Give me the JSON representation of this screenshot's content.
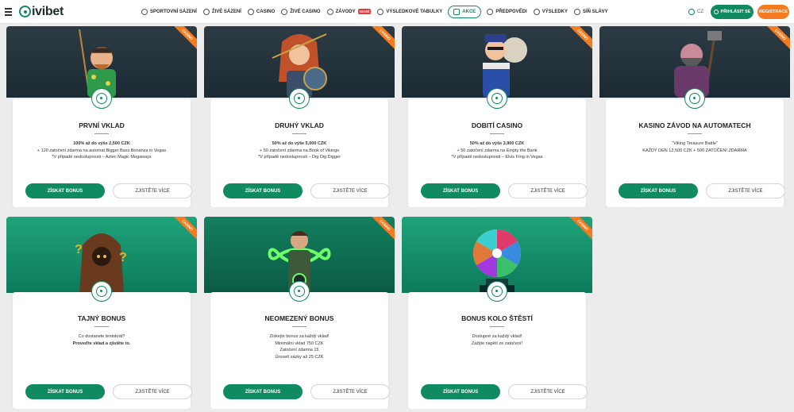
{
  "header": {
    "logo_text": "ivibet",
    "nav": [
      {
        "label": "SPORTOVNÍ SÁZENÍ",
        "icon": "soccer-ball-icon"
      },
      {
        "label": "ŽIVÉ SÁZENÍ",
        "icon": "live-icon"
      },
      {
        "label": "CASINO",
        "icon": "casino-chip-icon"
      },
      {
        "label": "ŽIVÉ CASINO",
        "icon": "live-casino-icon"
      },
      {
        "label": "ZÁVODY",
        "icon": "trophy-icon",
        "badge": "NOVÉ"
      },
      {
        "label": "VÝSLEDKOVÉ TABULKY",
        "icon": "leaderboard-icon"
      },
      {
        "label": "AKCE",
        "icon": "gift-icon",
        "active": true
      },
      {
        "label": "PŘEDPOVĚDI",
        "icon": "prediction-icon"
      },
      {
        "label": "VÝSLEDKY",
        "icon": "results-icon"
      },
      {
        "label": "SÍŇ SLÁVY",
        "icon": "hall-of-fame-icon"
      }
    ],
    "language": "CZ",
    "login_label": "PŘIHLÁSIT SE",
    "register_label": "REGISTRACE"
  },
  "colors": {
    "accent": "#0f8a61",
    "orange": "#f47b20",
    "badge_red": "#e73a3a"
  },
  "ribbon_text": "CASINO",
  "claim_label": "ZÍSKAT BONUS",
  "more_label": "ZJISTĚTE VÍCE",
  "cards": [
    {
      "title": "PRVNÍ VKLAD",
      "lines": [
        {
          "bold": "100%",
          "text": " až do výše "
        },
        {
          "bold": "",
          "text": "+ "
        },
        {
          "bold": "",
          "text": "*V případě nedostupnosti – Aztec Magic Megaways"
        }
      ],
      "line1": "100% až do výše 2,500 CZK",
      "line2": "+ 120 zatočení zdarma na automat Bigger Bass Bonanza in Vegas",
      "line3": "*V případě nedostupnosti – Aztec Magic Megaways",
      "hero": "fisherman-mascot"
    },
    {
      "title": "DRUHÝ VKLAD",
      "line1": "50% až do výše 5,000 CZK",
      "line2": "+ 50 zatočení zdarma na Book of Vikings",
      "line3": "*V případě nedostupnosti – Dig Dig Digger",
      "hero": "viking-woman-mascot"
    },
    {
      "title": "DOBITÍ CASINO",
      "line1": "50% až do výše 3,900 CZK",
      "line2": "+ 50 zatočení zdarma na Empty the Bank",
      "line3": "*V případě nedostupnosti – Elvis Frog in Vegas",
      "hero": "robber-mascot"
    },
    {
      "title": "KASINO ZÁVOD NA AUTOMATECH",
      "line1": "\"Viking Treasure Battle\"",
      "line2": "KAŽDÝ DEN 12,500 CZK + 500 ZATOČENÍ ZDARMA",
      "line3": "",
      "hero": "dwarf-warrior-mascot"
    },
    {
      "title": "TAJNÝ BONUS",
      "line1": "Co dostanete tentokrát?",
      "line2": "Proveďte vklad a zjistěte to.",
      "line3": "",
      "hero": "hooded-mystery-mascot"
    },
    {
      "title": "NEOMEZENÝ BONUS",
      "line1": "Získejte bonus za každý vklad!",
      "line2": "Minimální vklad 750 CZK",
      "line3": "Zatočení zdarma 15",
      "line4": "Úroveň sázky až 25 CZK",
      "hero": "infinity-explorer-mascot"
    },
    {
      "title": "BONUS KOLO ŠTĚSTÍ",
      "line1": "Dostupné za každý vklad!",
      "line2": "Zažijte napětí ze zatočení!",
      "line3": "",
      "hero": "wheel-of-fortune-icon"
    }
  ]
}
